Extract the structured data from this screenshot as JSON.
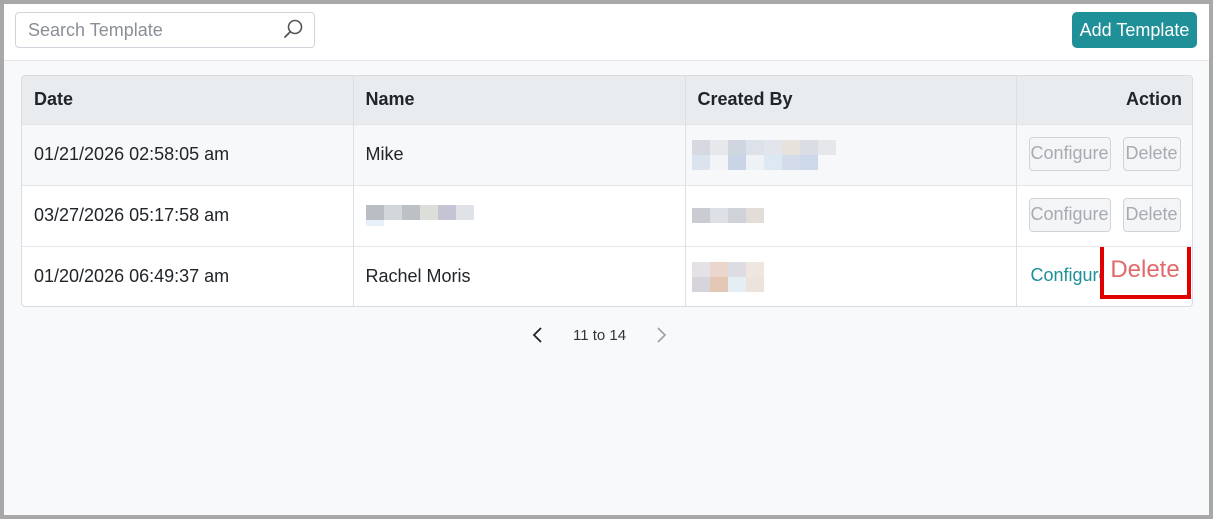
{
  "search": {
    "placeholder": "Search Template",
    "value": ""
  },
  "toolbar": {
    "add_label": "Add Template"
  },
  "table": {
    "headers": {
      "date": "Date",
      "name": "Name",
      "created_by": "Created By",
      "action": "Action"
    },
    "rows": [
      {
        "date": "01/21/2026 02:58:05 am",
        "name": "Mike",
        "configure": "Configure",
        "delete": "Delete"
      },
      {
        "date": "03/27/2026 05:17:58 am",
        "name": "",
        "configure": "Configure",
        "delete": "Delete"
      },
      {
        "date": "01/20/2026 06:49:37 am",
        "name": "Rachel Moris",
        "configure": "Configure",
        "delete": "Delete"
      }
    ]
  },
  "pagination": {
    "label": "11 to 14"
  },
  "colors": {
    "accent": "#1f8f98",
    "highlight": "#e00000",
    "delete_text": "#e06a6a"
  },
  "icons": {
    "search": "search-icon",
    "prev": "chevron-left-icon",
    "next": "chevron-right-icon"
  }
}
